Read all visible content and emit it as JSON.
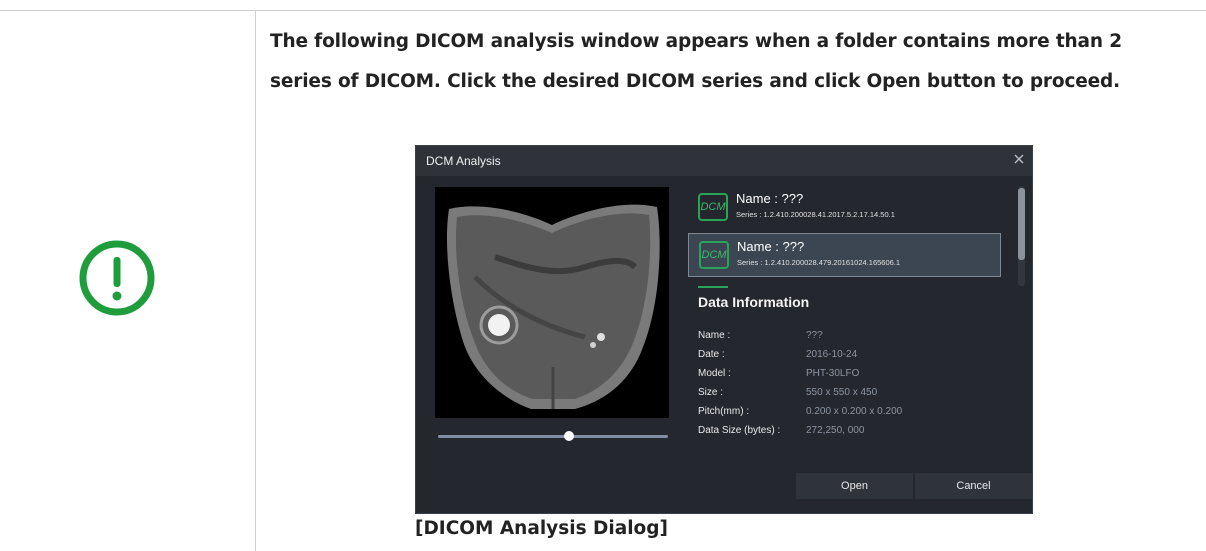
{
  "instruction": "The following DICOM analysis window appears when a folder contains more than 2 series of DICOM. Click the desired DICOM series and click Open button to proceed.",
  "caption": "[DICOM Analysis Dialog]",
  "icons": {
    "notice": "exclamation-circle-icon",
    "close": "close-icon",
    "series": "dcm-file-icon"
  },
  "colors": {
    "notice_green": "#1f9d3c",
    "dialog_bg": "#24272d",
    "accent_green": "#2aa35a"
  },
  "dialog": {
    "title": "DCM Analysis",
    "series_list": [
      {
        "icon_text": "DCM",
        "name": "Name : ???",
        "series": "Series : 1.2.410.200028.41.2017.5.2.17.14.50.1",
        "selected": false
      },
      {
        "icon_text": "DCM",
        "name": "Name : ???",
        "series": "Series : 1.2.410.200028.479.20161024.165606.1",
        "selected": true
      }
    ],
    "info": {
      "heading": "Data Information",
      "rows": [
        {
          "label": "Name :",
          "value": "???"
        },
        {
          "label": "Date :",
          "value": "2016-10-24"
        },
        {
          "label": "Model :",
          "value": "PHT-30LFO"
        },
        {
          "label": "Size :",
          "value": "550 x 550 x 450"
        },
        {
          "label": "Pitch(mm) :",
          "value": "0.200 x 0.200 x 0.200"
        },
        {
          "label": "Data Size (bytes) :",
          "value": "272,250, 000"
        }
      ]
    },
    "slider_position": 0.57,
    "buttons": {
      "open": "Open",
      "cancel": "Cancel"
    }
  }
}
